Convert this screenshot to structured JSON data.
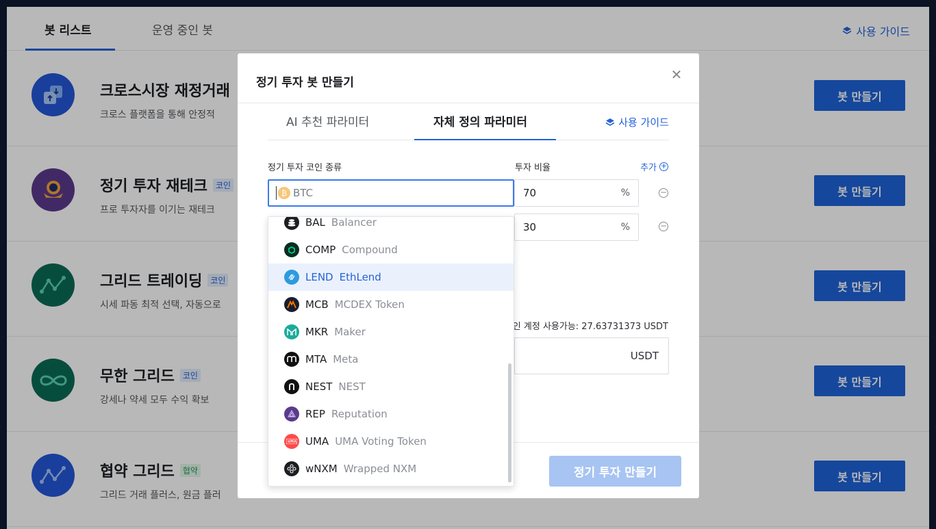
{
  "background": {
    "tabs": [
      {
        "label": "봇 리스트",
        "active": true
      },
      {
        "label": "운영 중인 봇",
        "active": false
      }
    ],
    "guide_label": "사용 가이드",
    "bots": [
      {
        "title": "크로스시장 재정거래",
        "badge": "",
        "desc": "크로스 플랫폼을 통해 안정적",
        "button": "봇 만들기",
        "icon": "cross-market-icon",
        "color": "#2357d9"
      },
      {
        "title": "정기 투자 재테크",
        "badge": "코인",
        "desc": "프로 투자자를 이기는 재테크",
        "button": "봇 만들기",
        "icon": "dca-icon",
        "color": "#5a3a8c"
      },
      {
        "title": "그리드 트레이딩",
        "badge": "코인",
        "desc": "시세 파동 최적 선택, 자동으로",
        "button": "봇 만들기",
        "icon": "grid-icon",
        "color": "#0b6b55"
      },
      {
        "title": "무한 그리드",
        "badge": "코인",
        "desc": "강세나 약세 모두 수익 확보",
        "button": "봇 만들기",
        "icon": "infinite-grid-icon",
        "color": "#0b6b55"
      },
      {
        "title": "협약 그리드",
        "badge": "협약",
        "desc": "그리드 거래 플러스, 원금 플러",
        "button": "봇 만들기",
        "icon": "contract-grid-icon",
        "color": "#2357d9"
      }
    ]
  },
  "modal": {
    "title": "정기 투자 봇 만들기",
    "tabs": [
      {
        "label": "AI 추천 파라미터",
        "active": false
      },
      {
        "label": "자체 정의 파라미터",
        "active": true
      }
    ],
    "guide_label": "사용 가이드",
    "coin_label": "정기 투자 코인 종류",
    "ratio_label": "투자 비율",
    "add_label": "추가",
    "coin_placeholder": "BTC",
    "rows": [
      {
        "ratio": "70",
        "unit": "%"
      },
      {
        "ratio": "30",
        "unit": "%"
      }
    ],
    "available_text": "인 계정 사용가능: 27.63731373 USDT",
    "amount_unit": "USDT",
    "create_button": "정기 투자 만들기"
  },
  "dropdown": {
    "items": [
      {
        "symbol": "BAL",
        "name": "Balancer",
        "logo_color": "#1c1e22",
        "highlighted": false
      },
      {
        "symbol": "COMP",
        "name": "Compound",
        "logo_color": "#0a2e20",
        "highlighted": false
      },
      {
        "symbol": "LEND",
        "name": "EthLend",
        "logo_color": "#2d9ae0",
        "highlighted": true
      },
      {
        "symbol": "MCB",
        "name": "MCDEX Token",
        "logo_color": "#1b1d2b",
        "highlighted": false
      },
      {
        "symbol": "MKR",
        "name": "Maker",
        "logo_color": "#1aab9b",
        "highlighted": false
      },
      {
        "symbol": "MTA",
        "name": "Meta",
        "logo_color": "#111111",
        "highlighted": false
      },
      {
        "symbol": "NEST",
        "name": "NEST",
        "logo_color": "#111111",
        "highlighted": false
      },
      {
        "symbol": "REP",
        "name": "Reputation",
        "logo_color": "#5b3b8c",
        "highlighted": false
      },
      {
        "symbol": "UMA",
        "name": "UMA Voting Token",
        "logo_color": "#ff4a4a",
        "highlighted": false
      },
      {
        "symbol": "wNXM",
        "name": "Wrapped NXM",
        "logo_color": "#1c1e22",
        "highlighted": false
      }
    ]
  },
  "colors": {
    "accent": "#1e63d8",
    "disabled_button": "#a7c4f2"
  }
}
